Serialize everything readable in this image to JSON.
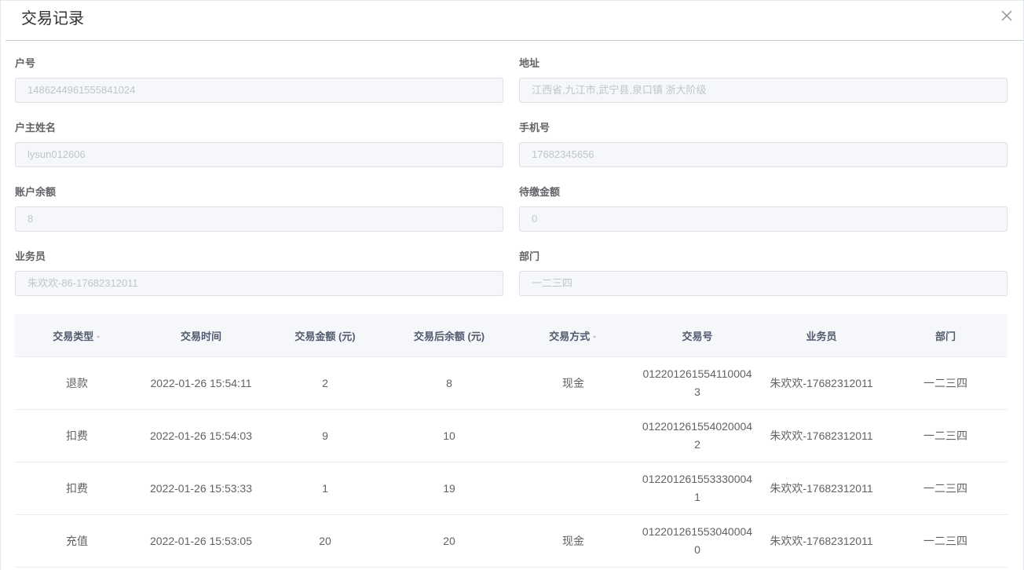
{
  "dialog": {
    "title": "交易记录",
    "close_icon": "close-icon"
  },
  "form": {
    "account_no": {
      "label": "户号",
      "value": "1486244961555841024"
    },
    "address": {
      "label": "地址",
      "value": "江西省,九江市,武宁县,泉口镇 浙大阶级"
    },
    "owner_name": {
      "label": "户主姓名",
      "value": "lysun012606"
    },
    "phone": {
      "label": "手机号",
      "value": "17682345656"
    },
    "balance": {
      "label": "账户余额",
      "value": "8"
    },
    "pending": {
      "label": "待缴金额",
      "value": "0"
    },
    "salesman": {
      "label": "业务员",
      "value": "朱欢欢-86-17682312011"
    },
    "department": {
      "label": "部门",
      "value": "一二三四"
    }
  },
  "table": {
    "headers": [
      "交易类型",
      "交易时间",
      "交易金额 (元)",
      "交易后余额 (元)",
      "交易方式",
      "交易号",
      "业务员",
      "部门"
    ],
    "sort_caret": "⌄",
    "rows": [
      [
        "退款",
        "2022-01-26 15:54:11",
        "2",
        "8",
        "现金",
        "0122012615541100043",
        "朱欢欢-17682312011",
        "一二三四"
      ],
      [
        "扣费",
        "2022-01-26 15:54:03",
        "9",
        "10",
        "",
        "0122012615540200042",
        "朱欢欢-17682312011",
        "一二三四"
      ],
      [
        "扣费",
        "2022-01-26 15:53:33",
        "1",
        "19",
        "",
        "0122012615533300041",
        "朱欢欢-17682312011",
        "一二三四"
      ],
      [
        "充值",
        "2022-01-26 15:53:05",
        "20",
        "20",
        "现金",
        "0122012615530400040",
        "朱欢欢-17682312011",
        "一二三四"
      ]
    ]
  }
}
